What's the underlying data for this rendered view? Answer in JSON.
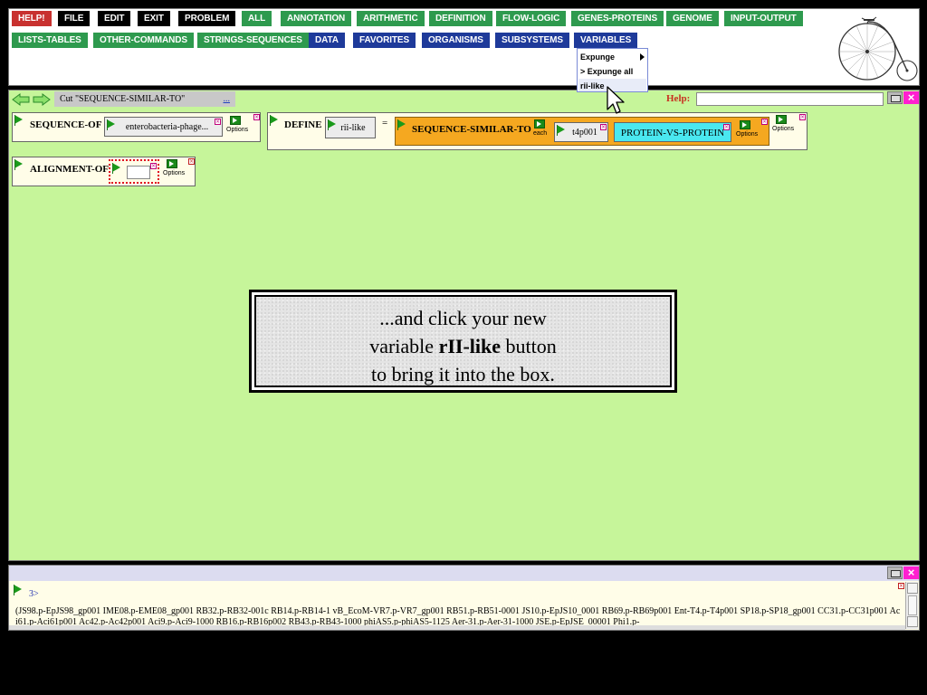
{
  "menu": {
    "row1": [
      {
        "label": "HELP!",
        "color": "#c8312f"
      },
      {
        "label": "FILE",
        "color": "#000000"
      },
      {
        "label": "EDIT",
        "color": "#000000"
      },
      {
        "label": "EXIT",
        "color": "#000000"
      },
      {
        "label": "PROBLEM",
        "color": "#000000"
      },
      {
        "label": "ALL",
        "color": "#2e9a4e"
      },
      {
        "label": "ANNOTATION",
        "color": "#2e9a4e"
      },
      {
        "label": "ARITHMETIC",
        "color": "#2e9a4e"
      },
      {
        "label": "DEFINITION",
        "color": "#2e9a4e"
      },
      {
        "label": "FLOW-LOGIC",
        "color": "#2e9a4e"
      },
      {
        "label": "GENES-PROTEINS",
        "color": "#2e9a4e"
      },
      {
        "label": "GENOME",
        "color": "#2e9a4e"
      },
      {
        "label": "INPUT-OUTPUT",
        "color": "#2e9a4e"
      }
    ],
    "row2": [
      {
        "label": "LISTS-TABLES",
        "color": "#2e9a4e"
      },
      {
        "label": "OTHER-COMMANDS",
        "color": "#2e9a4e"
      },
      {
        "label": "STRINGS-SEQUENCES",
        "color": "#2e9a4e"
      },
      {
        "label": "DATA",
        "color": "#1e3a9a"
      },
      {
        "label": "FAVORITES",
        "color": "#1e3a9a"
      },
      {
        "label": "ORGANISMS",
        "color": "#1e3a9a"
      },
      {
        "label": "SUBSYSTEMS",
        "color": "#1e3a9a"
      },
      {
        "label": "VARIABLES",
        "color": "#1e3a9a"
      }
    ]
  },
  "variables_dropdown": {
    "items": [
      "Expunge",
      "> Expunge all",
      "rii-like"
    ]
  },
  "workspace": {
    "cut_label": "Cut \"SEQUENCE-SIMILAR-TO\"",
    "cut_more": "...",
    "help_label": "Help:",
    "help_value": "",
    "sequence_of": {
      "title": "SEQUENCE-OF",
      "slot": "enterobacteria-phage...",
      "options": "Options"
    },
    "define": {
      "title": "DEFINE",
      "var_slot": "rii-like",
      "equals": "=",
      "func_title": "SEQUENCE-SIMILAR-TO",
      "each": "each",
      "arg1": "t4p001",
      "arg2": "PROTEIN-VS-PROTEIN",
      "options": "Options"
    },
    "alignment_of": {
      "title": "ALIGNMENT-OF",
      "options": "Options"
    }
  },
  "tooltip": {
    "line1": "...and click your new",
    "line2_pre": "variable ",
    "line2_bold": "rII-like",
    "line2_post": " button",
    "line3": "to bring it into the box."
  },
  "output": {
    "prompt": "3>",
    "text": "(JS98.p-EpJS98_gp001 IME08.p-EME08_gp001 RB32.p-RB32-001c RB14.p-RB14-1 vB_EcoM-VR7.p-VR7_gp001 RB51.p-RB51-0001 JS10.p-EpJS10_0001 RB69.p-RB69p001 Ent-T4.p-T4p001 SP18.p-SP18_gp001 CC31.p-CC31p001 Aci61.p-Aci61p001 Ac42.p-Ac42p001 Aci9.p-Aci9-1000 RB16.p-RB16p002 RB43.p-RB43-1000 phiAS5.p-phiAS5-1125 Aer-31.p-Aer-31-1000 JSE.p-EpJSE_00001 Phi1.p-"
  },
  "colors": {
    "workspace_bg": "#c6f59a",
    "box_bg": "#fffde8",
    "func_bg": "#f5a820",
    "arg2_bg": "#4ae8f0",
    "close_pink": "#ff1fd0"
  }
}
